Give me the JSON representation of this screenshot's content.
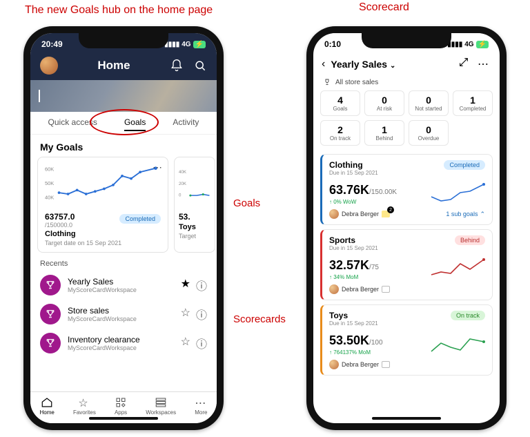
{
  "captions": {
    "left": "The new Goals hub on the home page",
    "right": "Scorecard",
    "goals": "Goals",
    "scorecards": "Scorecards"
  },
  "left": {
    "status_time": "20:49",
    "status_net": "4G",
    "header_title": "Home",
    "tabs": {
      "quick": "Quick access",
      "goals": "Goals",
      "activity": "Activity"
    },
    "my_goals_title": "My Goals",
    "card1": {
      "yticks": [
        "60K",
        "50K",
        "40K"
      ],
      "value": "63757.0",
      "target": "/150000.0",
      "status": "Completed",
      "title": "Clothing",
      "date": "Target date on 15 Sep 2021"
    },
    "card2": {
      "yticks": [
        "40K",
        "20K",
        "0"
      ],
      "value": "53.",
      "title": "Toys",
      "date": "Target"
    },
    "recents_title": "Recents",
    "recents": [
      {
        "name": "Yearly Sales",
        "ws": "MyScoreCardWorkspace",
        "starred": true
      },
      {
        "name": "Store sales",
        "ws": "MyScoreCardWorkspace",
        "starred": false
      },
      {
        "name": "Inventory clearance",
        "ws": "MyScoreCardWorkspace",
        "starred": false
      }
    ],
    "nav": {
      "home": "Home",
      "favorites": "Favorites",
      "apps": "Apps",
      "workspaces": "Workspaces",
      "more": "More"
    }
  },
  "right": {
    "status_time": "0:10",
    "status_net": "4G",
    "title": "Yearly Sales",
    "filter": "All store sales",
    "stats": [
      {
        "num": "4",
        "lbl": "Goals"
      },
      {
        "num": "0",
        "lbl": "At risk"
      },
      {
        "num": "0",
        "lbl": "Not started"
      },
      {
        "num": "1",
        "lbl": "Completed"
      },
      {
        "num": "2",
        "lbl": "On track"
      },
      {
        "num": "1",
        "lbl": "Behind"
      },
      {
        "num": "0",
        "lbl": "Overdue"
      }
    ],
    "metrics": [
      {
        "title": "Clothing",
        "due": "Due in 15 Sep 2021",
        "val": "63.76K",
        "target": "/150.00K",
        "change": "↑ 0% WoW",
        "status": "Completed",
        "owner": "Debra Berger",
        "sub": "1 sub goals",
        "badge": "2",
        "color": "blue"
      },
      {
        "title": "Sports",
        "due": "Due in 15 Sep 2021",
        "val": "32.57K",
        "target": "/75",
        "change": "↑ 34% MoM",
        "status": "Behind",
        "owner": "Debra Berger",
        "color": "red"
      },
      {
        "title": "Toys",
        "due": "Due in 15 Sep 2021",
        "val": "53.50K",
        "target": "/100",
        "change": "↑ 764137% MoM",
        "status": "On track",
        "owner": "Debra Berger",
        "color": "orange"
      }
    ]
  },
  "chart_data": [
    {
      "type": "line",
      "title": "Clothing goal trend",
      "ylim": [
        35000,
        65000
      ],
      "values": [
        42,
        41,
        44,
        41,
        43,
        45,
        48,
        55,
        53,
        59,
        63
      ],
      "unit": "K"
    },
    {
      "type": "line",
      "title": "Toys goal trend (peek)",
      "ylim": [
        0,
        40000
      ],
      "values": [
        2,
        2,
        3,
        2
      ],
      "unit": "K"
    },
    {
      "type": "line",
      "title": "Clothing sparkline",
      "values": [
        30,
        20,
        22,
        35,
        38,
        50
      ]
    },
    {
      "type": "line",
      "title": "Sports sparkline",
      "values": [
        20,
        24,
        22,
        40,
        30,
        48
      ]
    },
    {
      "type": "line",
      "title": "Toys sparkline",
      "values": [
        15,
        28,
        22,
        18,
        34,
        30
      ]
    }
  ]
}
